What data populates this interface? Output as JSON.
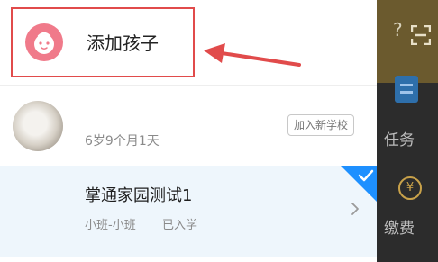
{
  "drawer": {
    "add_child_label": "添加孩子",
    "child": {
      "age": "6岁9个月1天",
      "join_school_label": "加入新学校"
    },
    "school": {
      "name": "掌通家园测试1",
      "class": "小班-小班",
      "status": "已入学",
      "selected": true
    }
  },
  "background_app": {
    "task_label": "任务",
    "fee_label": "缴费",
    "top_flag_char": "?",
    "money_icon_char": "¥"
  },
  "colors": {
    "highlight_border": "#e14b4b",
    "avatar_pink": "#f07a8a",
    "selected_blue": "#1e90ff",
    "selected_row_bg": "#eef6fc"
  },
  "icons": {
    "add_child": "baby-face-icon",
    "arrow": "red-arrow-pointer",
    "chevron": "chevron-right-icon",
    "selected": "checkmark-corner-icon",
    "scan": "scan-icon"
  }
}
